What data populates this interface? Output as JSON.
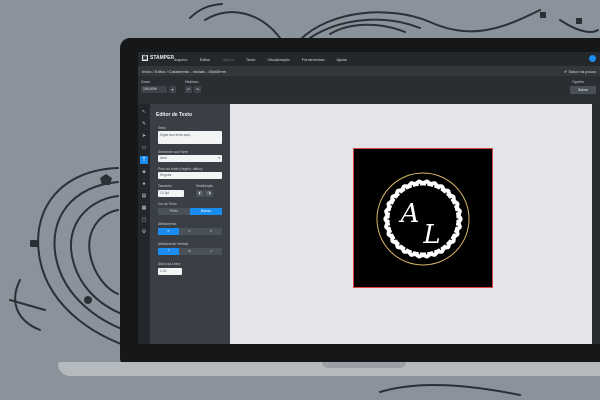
{
  "app": {
    "logo_text": "STAMPER",
    "menu": [
      "Arquivo",
      "Editar",
      "Objeto",
      "Texto",
      "Visualização",
      "Ferramentas",
      "Ajuda"
    ]
  },
  "breadcrumb": "Início  /  Editor  /  Casamento - Iniciais - 65x65mm",
  "save_status": "✔ Salvo há pouco",
  "toolbar": {
    "zoom_label": "Zoom",
    "zoom_value": "100,00%",
    "history_label": "Histórico",
    "options_label": "Opções",
    "salvar": "Salvar"
  },
  "panel": {
    "title": "Editor de Texto",
    "text_label": "Texto",
    "text_placeholder": "Digite seu texto aqui...",
    "font_label": "Selecione sua Fonte",
    "font_value": "Arial",
    "style_label": "Peso da fonte (Negrito, Itálico)",
    "style_value": "Regular",
    "size_label": "Tamanho",
    "size_value": "13.3pt",
    "position_label": "Distribuição",
    "color_label": "Cor do Texto",
    "color_options": [
      "Preto",
      "Branco"
    ],
    "align_label": "Alinhamento",
    "valign_label": "Alinhamento Vertical",
    "lineheight_label": "Altura da Linha",
    "lineheight_value": "1,00"
  },
  "artboard": {
    "initials": [
      "A",
      "L"
    ]
  },
  "colors": {
    "accent": "#1b8df0",
    "artboard_border": "#e0463e",
    "ring": "#d9b56a"
  },
  "icons": [
    "select-icon",
    "pen-icon",
    "arrow-icon",
    "image-icon",
    "text-icon",
    "fill-icon",
    "shape-icon",
    "layers-icon",
    "qr-icon",
    "template-icon",
    "settings-icon"
  ]
}
